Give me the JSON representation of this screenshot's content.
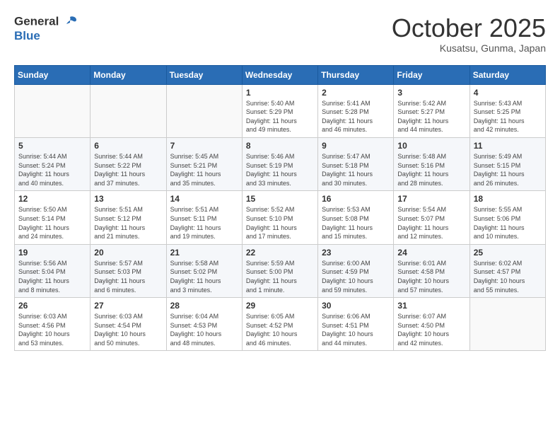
{
  "header": {
    "logo_line1": "General",
    "logo_line2": "Blue",
    "month": "October 2025",
    "location": "Kusatsu, Gunma, Japan"
  },
  "weekdays": [
    "Sunday",
    "Monday",
    "Tuesday",
    "Wednesday",
    "Thursday",
    "Friday",
    "Saturday"
  ],
  "weeks": [
    [
      {
        "day": "",
        "info": ""
      },
      {
        "day": "",
        "info": ""
      },
      {
        "day": "",
        "info": ""
      },
      {
        "day": "1",
        "info": "Sunrise: 5:40 AM\nSunset: 5:29 PM\nDaylight: 11 hours\nand 49 minutes."
      },
      {
        "day": "2",
        "info": "Sunrise: 5:41 AM\nSunset: 5:28 PM\nDaylight: 11 hours\nand 46 minutes."
      },
      {
        "day": "3",
        "info": "Sunrise: 5:42 AM\nSunset: 5:27 PM\nDaylight: 11 hours\nand 44 minutes."
      },
      {
        "day": "4",
        "info": "Sunrise: 5:43 AM\nSunset: 5:25 PM\nDaylight: 11 hours\nand 42 minutes."
      }
    ],
    [
      {
        "day": "5",
        "info": "Sunrise: 5:44 AM\nSunset: 5:24 PM\nDaylight: 11 hours\nand 40 minutes."
      },
      {
        "day": "6",
        "info": "Sunrise: 5:44 AM\nSunset: 5:22 PM\nDaylight: 11 hours\nand 37 minutes."
      },
      {
        "day": "7",
        "info": "Sunrise: 5:45 AM\nSunset: 5:21 PM\nDaylight: 11 hours\nand 35 minutes."
      },
      {
        "day": "8",
        "info": "Sunrise: 5:46 AM\nSunset: 5:19 PM\nDaylight: 11 hours\nand 33 minutes."
      },
      {
        "day": "9",
        "info": "Sunrise: 5:47 AM\nSunset: 5:18 PM\nDaylight: 11 hours\nand 30 minutes."
      },
      {
        "day": "10",
        "info": "Sunrise: 5:48 AM\nSunset: 5:16 PM\nDaylight: 11 hours\nand 28 minutes."
      },
      {
        "day": "11",
        "info": "Sunrise: 5:49 AM\nSunset: 5:15 PM\nDaylight: 11 hours\nand 26 minutes."
      }
    ],
    [
      {
        "day": "12",
        "info": "Sunrise: 5:50 AM\nSunset: 5:14 PM\nDaylight: 11 hours\nand 24 minutes."
      },
      {
        "day": "13",
        "info": "Sunrise: 5:51 AM\nSunset: 5:12 PM\nDaylight: 11 hours\nand 21 minutes."
      },
      {
        "day": "14",
        "info": "Sunrise: 5:51 AM\nSunset: 5:11 PM\nDaylight: 11 hours\nand 19 minutes."
      },
      {
        "day": "15",
        "info": "Sunrise: 5:52 AM\nSunset: 5:10 PM\nDaylight: 11 hours\nand 17 minutes."
      },
      {
        "day": "16",
        "info": "Sunrise: 5:53 AM\nSunset: 5:08 PM\nDaylight: 11 hours\nand 15 minutes."
      },
      {
        "day": "17",
        "info": "Sunrise: 5:54 AM\nSunset: 5:07 PM\nDaylight: 11 hours\nand 12 minutes."
      },
      {
        "day": "18",
        "info": "Sunrise: 5:55 AM\nSunset: 5:06 PM\nDaylight: 11 hours\nand 10 minutes."
      }
    ],
    [
      {
        "day": "19",
        "info": "Sunrise: 5:56 AM\nSunset: 5:04 PM\nDaylight: 11 hours\nand 8 minutes."
      },
      {
        "day": "20",
        "info": "Sunrise: 5:57 AM\nSunset: 5:03 PM\nDaylight: 11 hours\nand 6 minutes."
      },
      {
        "day": "21",
        "info": "Sunrise: 5:58 AM\nSunset: 5:02 PM\nDaylight: 11 hours\nand 3 minutes."
      },
      {
        "day": "22",
        "info": "Sunrise: 5:59 AM\nSunset: 5:00 PM\nDaylight: 11 hours\nand 1 minute."
      },
      {
        "day": "23",
        "info": "Sunrise: 6:00 AM\nSunset: 4:59 PM\nDaylight: 10 hours\nand 59 minutes."
      },
      {
        "day": "24",
        "info": "Sunrise: 6:01 AM\nSunset: 4:58 PM\nDaylight: 10 hours\nand 57 minutes."
      },
      {
        "day": "25",
        "info": "Sunrise: 6:02 AM\nSunset: 4:57 PM\nDaylight: 10 hours\nand 55 minutes."
      }
    ],
    [
      {
        "day": "26",
        "info": "Sunrise: 6:03 AM\nSunset: 4:56 PM\nDaylight: 10 hours\nand 53 minutes."
      },
      {
        "day": "27",
        "info": "Sunrise: 6:03 AM\nSunset: 4:54 PM\nDaylight: 10 hours\nand 50 minutes."
      },
      {
        "day": "28",
        "info": "Sunrise: 6:04 AM\nSunset: 4:53 PM\nDaylight: 10 hours\nand 48 minutes."
      },
      {
        "day": "29",
        "info": "Sunrise: 6:05 AM\nSunset: 4:52 PM\nDaylight: 10 hours\nand 46 minutes."
      },
      {
        "day": "30",
        "info": "Sunrise: 6:06 AM\nSunset: 4:51 PM\nDaylight: 10 hours\nand 44 minutes."
      },
      {
        "day": "31",
        "info": "Sunrise: 6:07 AM\nSunset: 4:50 PM\nDaylight: 10 hours\nand 42 minutes."
      },
      {
        "day": "",
        "info": ""
      }
    ]
  ]
}
